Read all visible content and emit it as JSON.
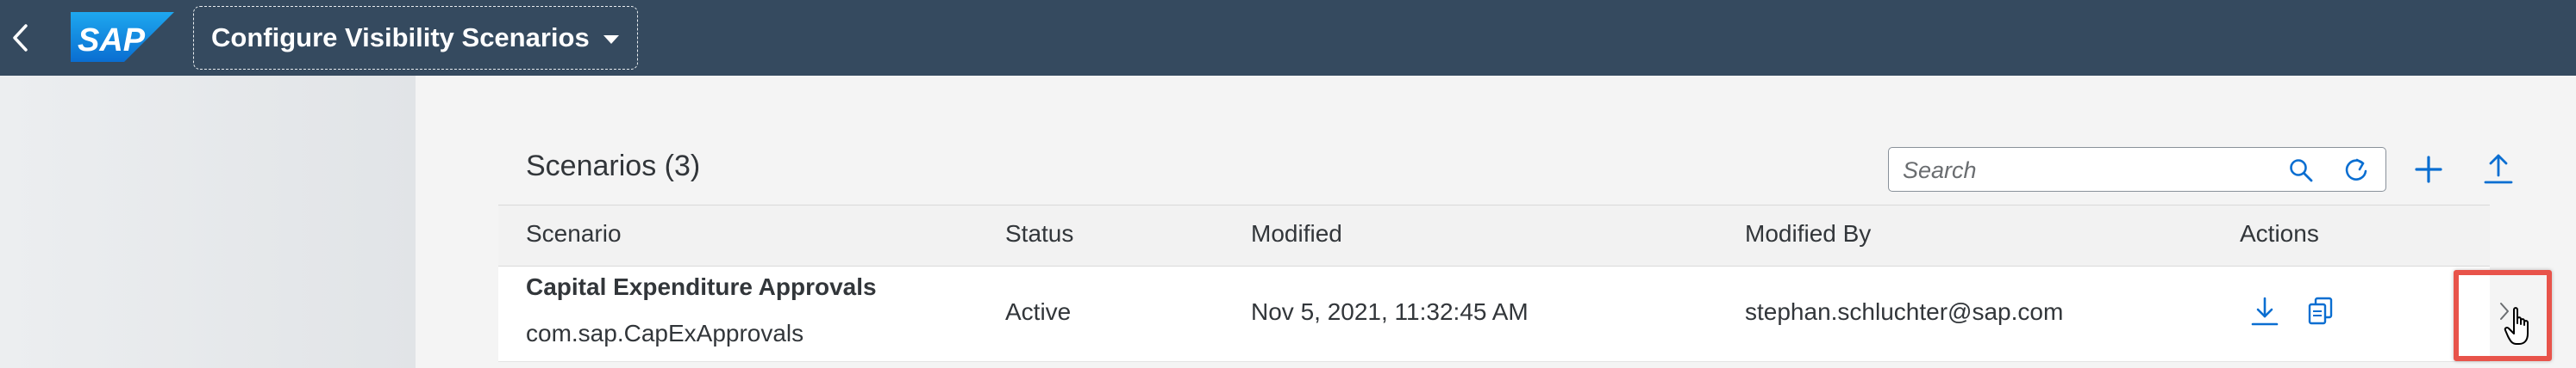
{
  "shell": {
    "logo_text": "SAP",
    "title": "Configure Visibility Scenarios"
  },
  "table": {
    "heading": "Scenarios (3)",
    "search_placeholder": "Search",
    "columns": [
      "Scenario",
      "Status",
      "Modified",
      "Modified By",
      "Actions"
    ],
    "rows": [
      {
        "name": "Capital Expenditure Approvals",
        "id": "com.sap.CapExApprovals",
        "status": "Active",
        "modified": "Nov 5, 2021, 11:32:45 AM",
        "modified_by": "stephan.schluchter@sap.com"
      }
    ]
  },
  "colors": {
    "shell_bg": "#354a5f",
    "accent": "#0a6ed1",
    "highlight": "#e8534a"
  },
  "icons": [
    "back-icon",
    "sap-logo",
    "caret-down-icon",
    "search-icon",
    "refresh-icon",
    "add-icon",
    "upload-icon",
    "download-icon",
    "copy-icon",
    "navigation-arrow-icon",
    "hand-cursor-icon"
  ]
}
